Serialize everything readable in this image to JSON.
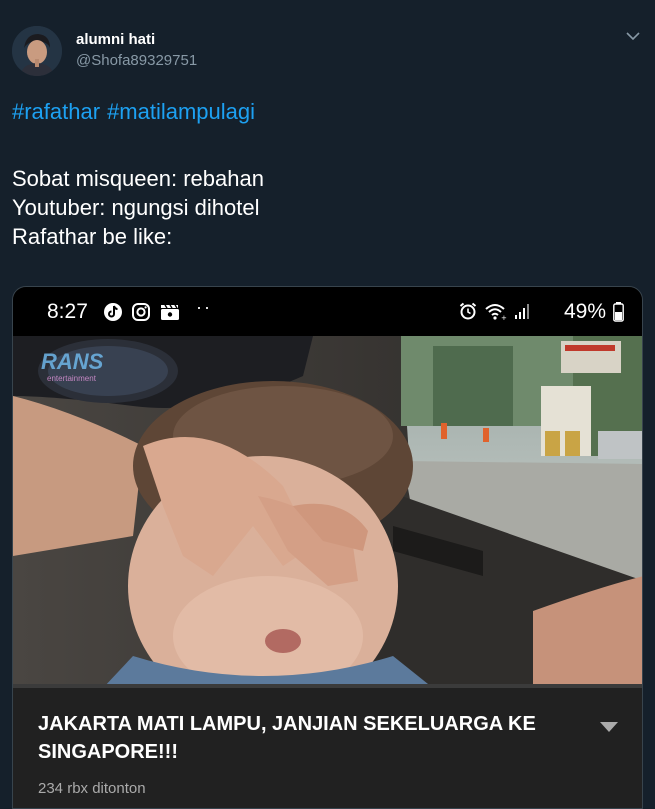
{
  "user": {
    "display_name": "alumni hati",
    "handle": "@Shofa89329751"
  },
  "tweet": {
    "hashtags": [
      "#rafathar",
      "#matilampulagi"
    ],
    "lines": [
      "Sobat misqueen: rebahan",
      "Youtuber: ngungsi dihotel",
      "Rafathar be like:"
    ]
  },
  "media": {
    "status_bar": {
      "time": "8:27",
      "dots": "··",
      "battery": "49%",
      "icons_left": [
        "tiktok-icon",
        "instagram-icon",
        "clapper-icon"
      ],
      "icons_right": [
        "alarm-icon",
        "wifi-icon",
        "signal-icon",
        "battery-icon"
      ]
    },
    "video": {
      "watermark": "RANS Entertainment",
      "progress": 0.0
    },
    "title": "JAKARTA MATI LAMPU, JANJIAN SEKELUARGA KE SINGAPORE!!!",
    "views": "234 rbx ditonton"
  },
  "colors": {
    "background": "#15202b",
    "link": "#1da1f2",
    "secondary_text": "#8899a6",
    "card_background": "#212121"
  }
}
